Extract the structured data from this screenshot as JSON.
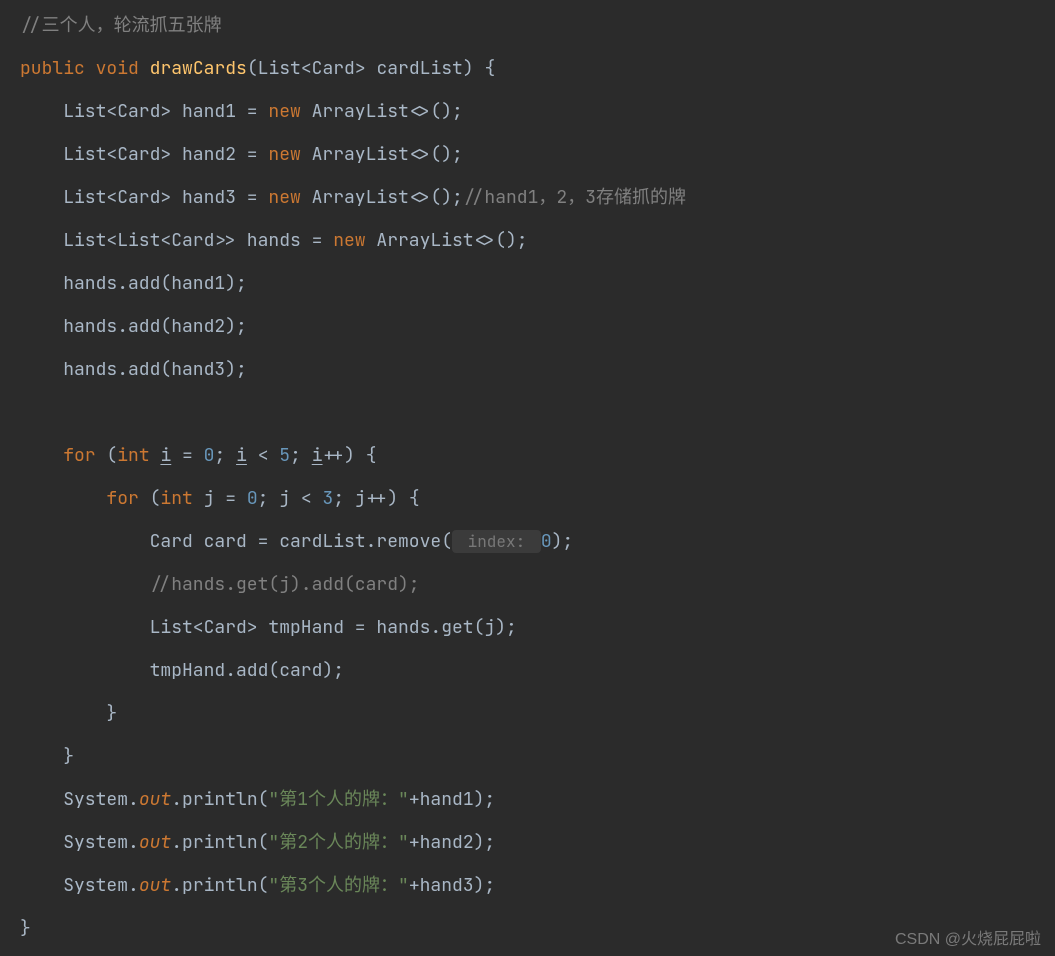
{
  "code": {
    "l1_cmt": "//三个人，轮流抓五张牌",
    "l2_pub": "public",
    "l2_void": "void",
    "l2_fn": "drawCards",
    "l2_sig": "(List<Card> cardList) {",
    "l3_a": "    List<Card> hand1 = ",
    "l3_new": "new",
    "l3_b": " ArrayList<>();",
    "l4_a": "    List<Card> hand2 = ",
    "l4_b": " ArrayList<>();",
    "l5_a": "    List<Card> hand3 = ",
    "l5_b": " ArrayList<>();",
    "l5_cmt": "//hand1，2，3存储抓的牌",
    "l6_a": "    List<List<Card>> hands = ",
    "l6_b": " ArrayList<>();",
    "l7": "    hands.add(hand1);",
    "l8": "    hands.add(hand2);",
    "l9": "    hands.add(hand3);",
    "blank": "",
    "l11_for": "for",
    "l11_int": "int",
    "l11_a": "    ",
    "l11_b": " (",
    "l11_c": " ",
    "l11_i": "i",
    "l11_eq": " = ",
    "l11_zero": "0",
    "l11_sc1": "; ",
    "l11_lt": " < ",
    "l11_five": "5",
    "l11_sc2": "; ",
    "l11_pp": "++) {",
    "l12_a": "        ",
    "l12_b": " (",
    "l12_j": "j",
    "l12_three": "3",
    "l13_a": "            Card card = cardList.remove(",
    "l13_hint": " index: ",
    "l13_zero": "0",
    "l13_end": ");",
    "l14_cmt": "            //hands.get(j).add(card);",
    "l15": "            List<Card> tmpHand = hands.get(j);",
    "l16": "            tmpHand.add(card);",
    "l17": "        }",
    "l18": "    }",
    "l19_a": "    System.",
    "l19_out": "out",
    "l19_b": ".println(",
    "l19_s": "\"第1个人的牌：\"",
    "l19_c": "+hand1);",
    "l20_s": "\"第2个人的牌：\"",
    "l20_c": "+hand2);",
    "l21_s": "\"第3个人的牌：\"",
    "l21_c": "+hand3);",
    "l22": "}"
  },
  "watermark": "CSDN @火烧屁屁啦"
}
